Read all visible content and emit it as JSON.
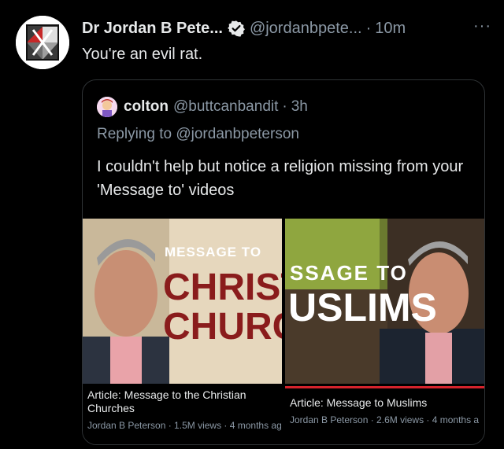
{
  "tweet": {
    "author_name": "Dr Jordan B Pete...",
    "handle": "@jordanbpete...",
    "separator": "·",
    "time": "10m",
    "more": "···",
    "text": "You're an evil rat."
  },
  "quote": {
    "author_name": "colton",
    "handle": "@buttcanbandit",
    "separator": "·",
    "time": "3h",
    "replying_prefix": "Replying to",
    "replying_to": "@jordanbpeterson",
    "text": "I couldn't help but notice a religion missing from your 'Message to' videos"
  },
  "cards": [
    {
      "thumb_kicker": "MESSAGE TO",
      "thumb_line1": "CHRISTI",
      "thumb_line2": "CHURCH",
      "title": "Article: Message to the Christian Churches",
      "meta": "Jordan B Peterson · 1.5M views · 4 months ag"
    },
    {
      "thumb_kicker": "SSAGE TO",
      "thumb_line1": "USLIMS",
      "title": "Article: Message to Muslims",
      "meta": "Jordan B Peterson · 2.6M views · 4 months a"
    }
  ],
  "colors": {
    "background": "#000000",
    "text": "#e7e9ea",
    "secondary": "#8b98a5",
    "verified": "#e7e9ea",
    "progress_red": "#d5232c"
  },
  "icons": [
    "verified-badge-icon",
    "more-icon"
  ]
}
